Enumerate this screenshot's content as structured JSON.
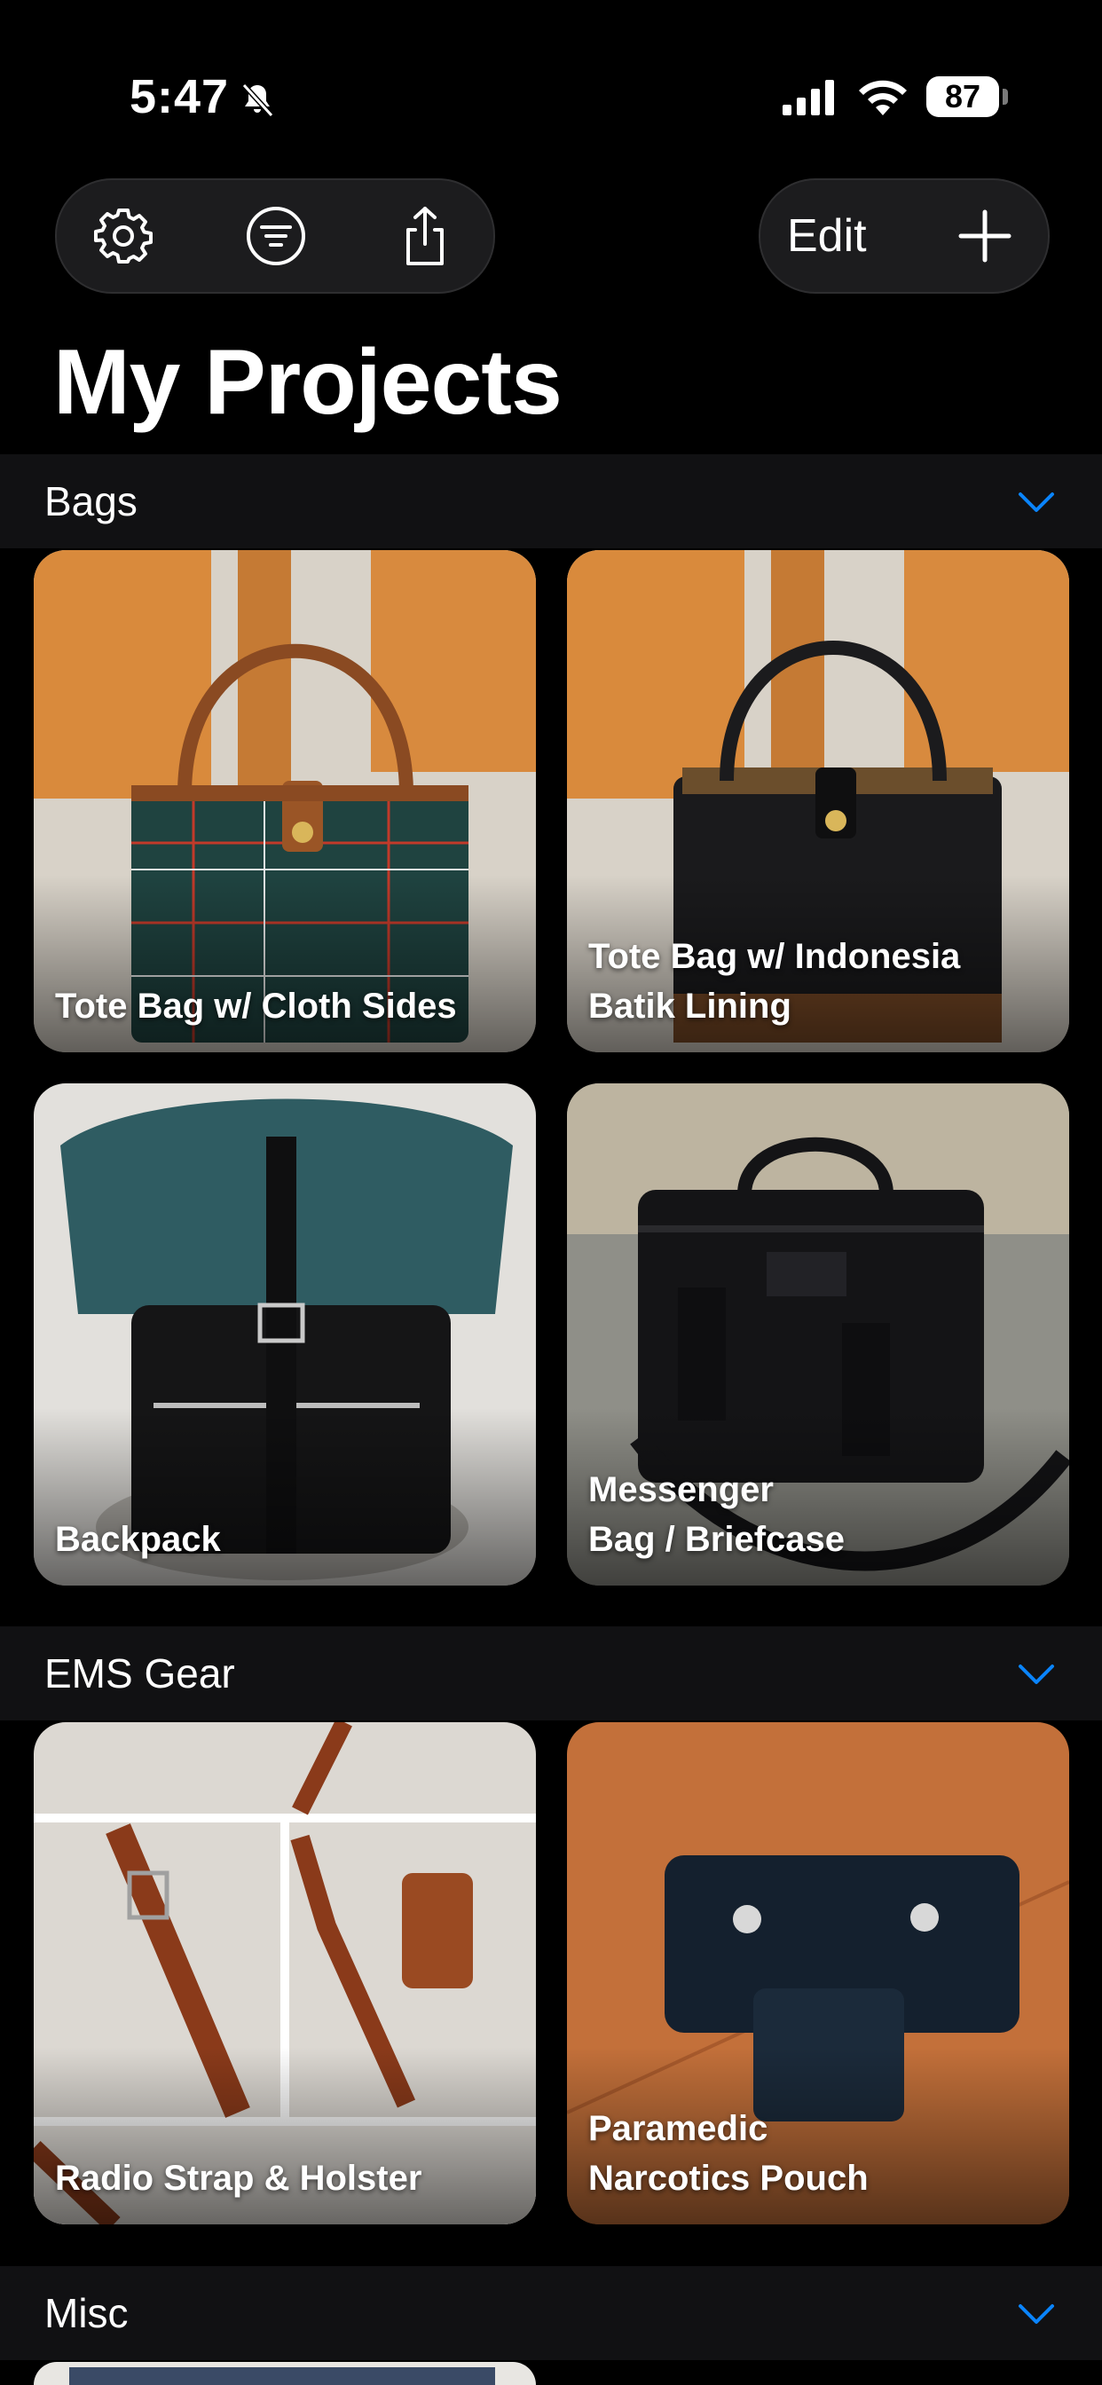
{
  "status_bar": {
    "time": "5:47",
    "battery": "87",
    "icons": [
      "bell-slash-icon",
      "cellular-signal-icon",
      "wifi-icon",
      "battery-icon"
    ]
  },
  "toolbar": {
    "left_icons": [
      "gear-icon",
      "filter-icon",
      "share-icon"
    ],
    "edit_label": "Edit",
    "add_icon": "plus-icon"
  },
  "page": {
    "title": "My Projects"
  },
  "sections": [
    {
      "title": "Bags",
      "items": [
        {
          "label": "Tote Bag w/ Cloth Sides"
        },
        {
          "label": "Tote Bag w/ Indonesia\nBatik Lining"
        },
        {
          "label": "Backpack"
        },
        {
          "label": "Messenger\nBag / Briefcase"
        }
      ]
    },
    {
      "title": "EMS Gear",
      "items": [
        {
          "label": "Radio Strap & Holster"
        },
        {
          "label": "Paramedic\nNarcotics Pouch"
        }
      ]
    },
    {
      "title": "Misc",
      "items": []
    }
  ],
  "colors": {
    "background": "#000000",
    "section_header": "#111113",
    "accent": "#0a84ff",
    "pill": "#1c1c1e"
  }
}
